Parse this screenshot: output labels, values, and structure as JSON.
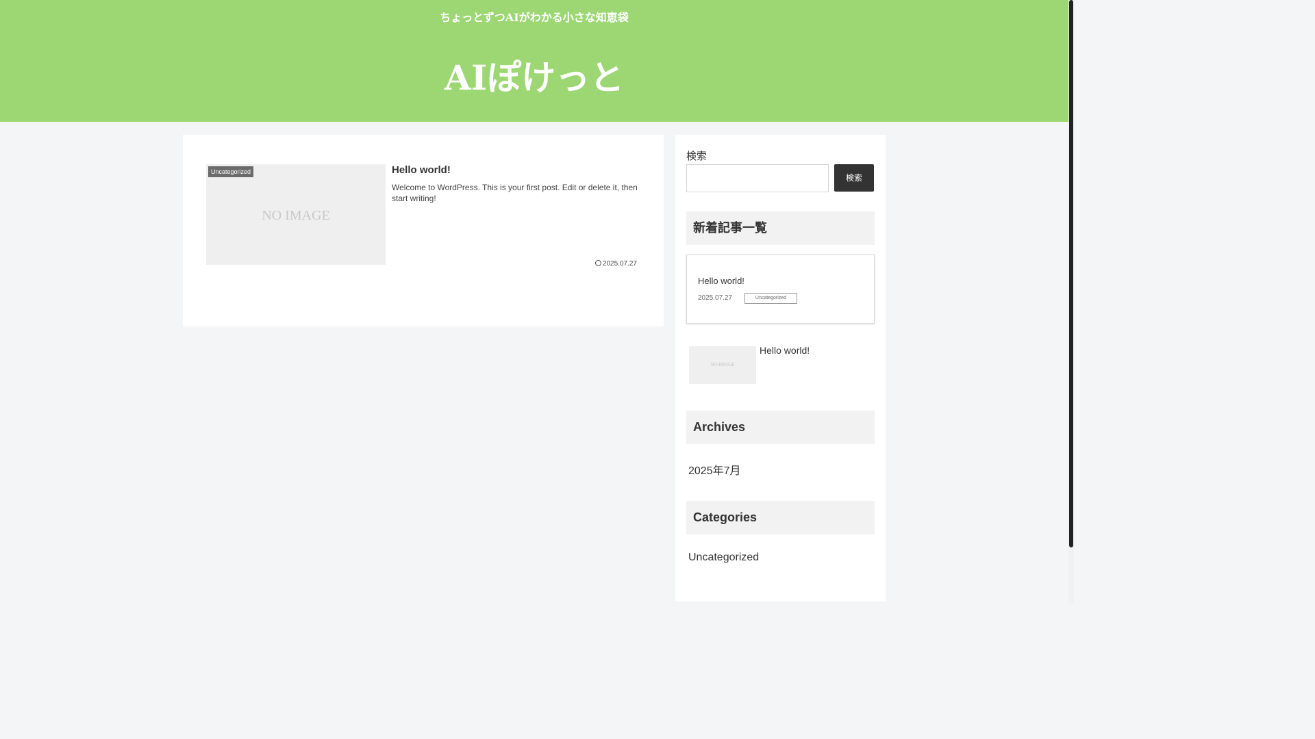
{
  "header": {
    "tagline": "ちょっとずつAIがわかる小さな知恵袋",
    "site_title": "AIぽけっと",
    "bg_color": "#9cd773"
  },
  "post": {
    "category": "Uncategorized",
    "no_image": "NO IMAGE",
    "title": "Hello world!",
    "excerpt": "Welcome to WordPress. This is your first post. Edit or delete it, then start writing!",
    "date": "2025.07.27"
  },
  "sidebar": {
    "search": {
      "label": "検索",
      "button": "検索",
      "value": ""
    },
    "new_posts": {
      "heading": "新着記事一覧",
      "card": {
        "title": "Hello world!",
        "date": "2025.07.27",
        "category": "Uncategorized"
      },
      "list_item": {
        "no_image": "NO IMAGE",
        "title": "Hello world!"
      }
    },
    "archives": {
      "heading": "Archives",
      "items": [
        "2025年7月"
      ]
    },
    "categories": {
      "heading": "Categories",
      "items": [
        "Uncategorized"
      ]
    }
  }
}
